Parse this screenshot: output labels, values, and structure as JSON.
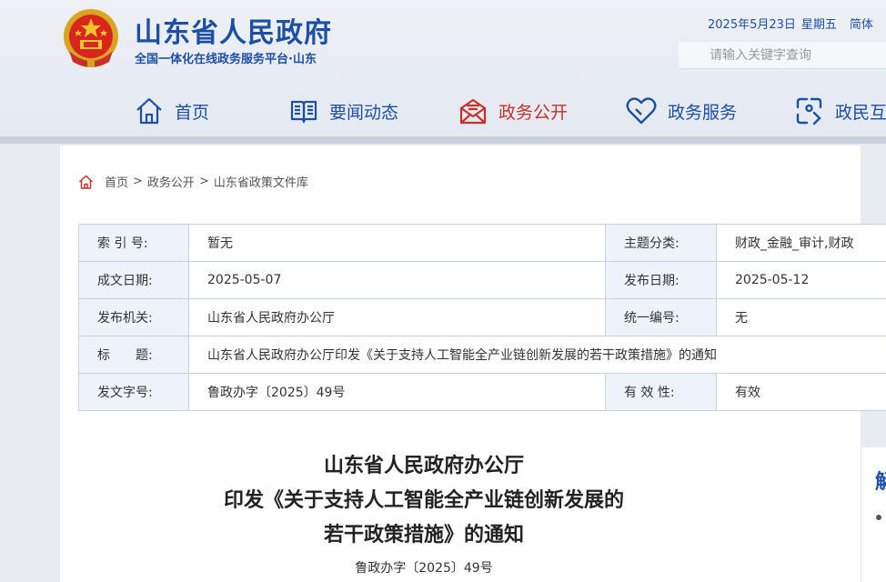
{
  "header": {
    "title": "山东省人民政府",
    "subtitle": "全国一体化在线政务服务平台·山东",
    "date": "2025年5月23日",
    "weekday": "星期五",
    "lang": "简体",
    "search_placeholder": "请输入关键字查询"
  },
  "nav": {
    "items": [
      {
        "label": "首页",
        "icon": "home-icon"
      },
      {
        "label": "要闻动态",
        "icon": "book-icon"
      },
      {
        "label": "政务公开",
        "icon": "envelope-icon"
      },
      {
        "label": "政务服务",
        "icon": "heart-icon"
      },
      {
        "label": "政民互",
        "icon": "interaction-icon"
      }
    ],
    "active_color": "#c8302b",
    "color": "#1d4fa5"
  },
  "breadcrumb": {
    "items": [
      "首页",
      "政务公开",
      "山东省政策文件库"
    ],
    "separator": ">"
  },
  "info": {
    "index_label": "索 引 号:",
    "index_value": "暂无",
    "topic_label": "主题分类:",
    "topic_value": "财政_金融_审计,财政",
    "created_label": "成文日期:",
    "created_value": "2025-05-07",
    "published_label": "发布日期:",
    "published_value": "2025-05-12",
    "issuer_label": "发布机关:",
    "issuer_value": "山东省人民政府办公厅",
    "code_label": "统一编号:",
    "code_value": "无",
    "title_label": "标　　题:",
    "title_value": "山东省人民政府办公厅印发《关于支持人工智能全产业链创新发展的若干政策措施》的通知",
    "docno_label": "发文字号:",
    "docno_value": "鲁政办字〔2025〕49号",
    "validity_label": "有 效 性:",
    "validity_value": "有效"
  },
  "document": {
    "title_line1": "山东省人民政府办公厅",
    "title_line2": "印发《关于支持人工智能全产业链创新发展的",
    "title_line3": "若干政策措施》的通知",
    "number": "鲁政办字〔2025〕49号"
  },
  "side": {
    "char": "解"
  }
}
